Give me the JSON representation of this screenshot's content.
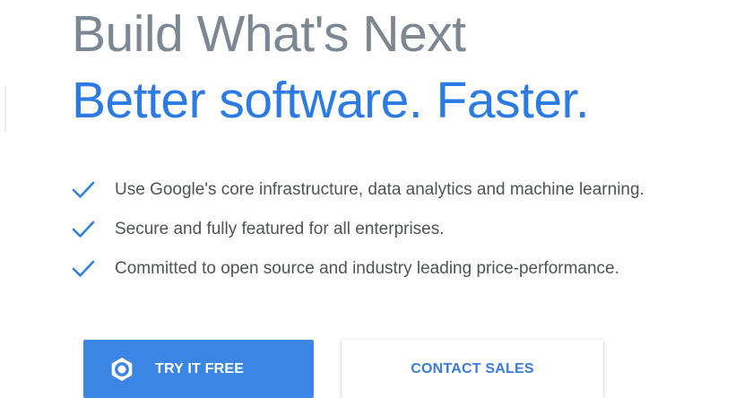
{
  "hero": {
    "title_line1": "Build What's Next",
    "title_line2": "Better software. Faster."
  },
  "features": [
    {
      "icon": "check-icon",
      "text": "Use Google's core infrastructure, data analytics and machine learning."
    },
    {
      "icon": "check-icon",
      "text": "Secure and fully featured for all enterprises."
    },
    {
      "icon": "check-icon",
      "text": "Committed to open source and industry leading price-performance."
    }
  ],
  "buttons": {
    "try_label": "TRY IT FREE",
    "try_icon": "google-cloud-icon",
    "contact_label": "CONTACT SALES"
  },
  "colors": {
    "headline_gray": "#7b8792",
    "headline_blue": "#2c7be5",
    "accent_blue": "#3b86e5",
    "check_blue": "#2f7fe0",
    "body_text": "#4f5356"
  }
}
